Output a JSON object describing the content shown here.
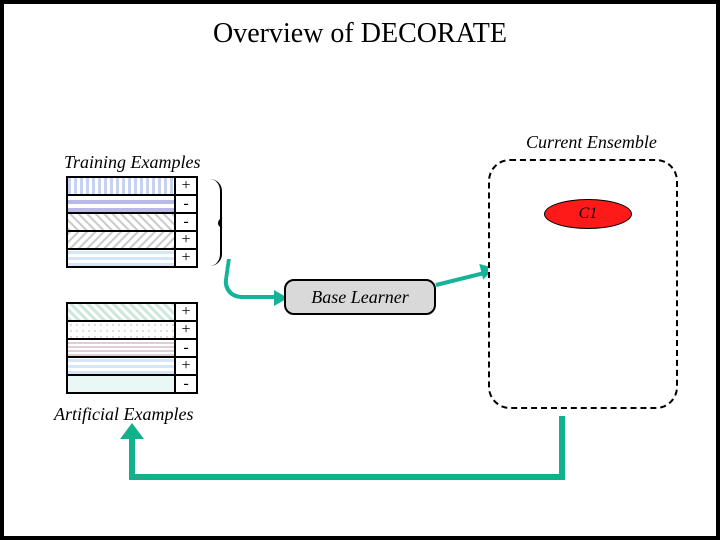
{
  "title": "Overview of DECORATE",
  "labels": {
    "training": "Training Examples",
    "artificial": "Artificial Examples",
    "ensemble": "Current Ensemble",
    "base_learner": "Base Learner",
    "c1": "C1"
  },
  "training_rows": [
    {
      "sign": "+"
    },
    {
      "sign": "-"
    },
    {
      "sign": "-"
    },
    {
      "sign": "+"
    },
    {
      "sign": "+"
    }
  ],
  "artificial_rows": [
    {
      "sign": "+"
    },
    {
      "sign": "+"
    },
    {
      "sign": "-"
    },
    {
      "sign": "+"
    },
    {
      "sign": "-"
    }
  ],
  "colors": {
    "accent_arrow": "#14b39a",
    "return_arrow": "#11b28a",
    "ensemble_member": "#ff1a1a",
    "baselearner_fill": "#d9d9d9"
  }
}
